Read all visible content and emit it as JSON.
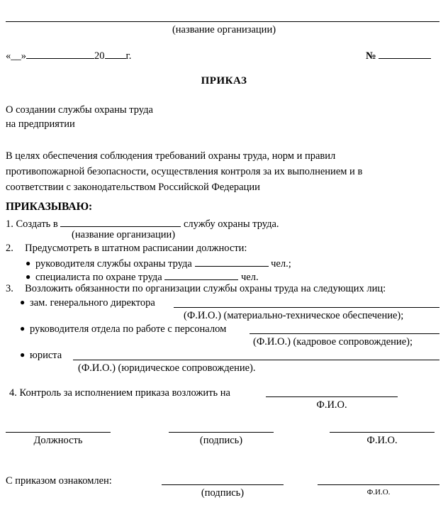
{
  "document": {
    "header": {
      "org_caption": "(название организации)",
      "date_prefix": "«__»",
      "date_year": "20",
      "date_suffix": "г.",
      "number_symbol": "№"
    },
    "title": "ПРИКАЗ",
    "subject_line_1": "О создании службы охраны труда",
    "subject_line_2": "на предприятии",
    "preamble_line_1": "В целях обеспечения соблюдения требований охраны труда, норм и правил",
    "preamble_line_2": "противопожарной безопасности, осуществления контроля за их выполнением и в",
    "preamble_line_3": "соответствии с законодательством Российской Федерации",
    "order_heading": "ПРИКАЗЫВАЮ:",
    "items": [
      {
        "number": "1.",
        "text_before": "Создать в",
        "text_after": "службу охраны труда.",
        "caption": "(название организации)"
      },
      {
        "number": "2.",
        "text_before": "Предусмотреть в штатном расписании должности:",
        "text_after": "",
        "caption": ""
      },
      {
        "number": "3.",
        "text_before": "Возложить обязанности по организации службы охраны труда на следующих лиц:",
        "text_after": "",
        "caption": ""
      },
      {
        "number": "4.",
        "text_before": "Контроль за исполнением приказа возложить на",
        "text_after": "",
        "caption": "Ф.И.О."
      }
    ],
    "staffing_bullets": [
      {
        "label": "руководителя службы охраны труда",
        "unit": "чел.;"
      },
      {
        "label": "специалиста по охране труда",
        "unit": "чел."
      }
    ],
    "responsible_bullets": [
      {
        "label": "зам. генерального директора",
        "caption": "(Ф.И.О.) (материально-техническое обеспечение);"
      },
      {
        "label": "руководителя отдела по работе с персоналом",
        "caption": "(Ф.И.О.) (кадровое сопровождение);"
      },
      {
        "label": "юриста",
        "caption": "(Ф.И.О.) (юридическое сопровождение)."
      }
    ],
    "signature_block": {
      "position_label": "Должность",
      "signature_label": "(подпись)",
      "name_label": "Ф.И.О."
    },
    "acknowledgement": {
      "text": "С приказом ознакомлен:",
      "signature_label": "(подпись)",
      "name_label": "Ф.И.О."
    }
  }
}
